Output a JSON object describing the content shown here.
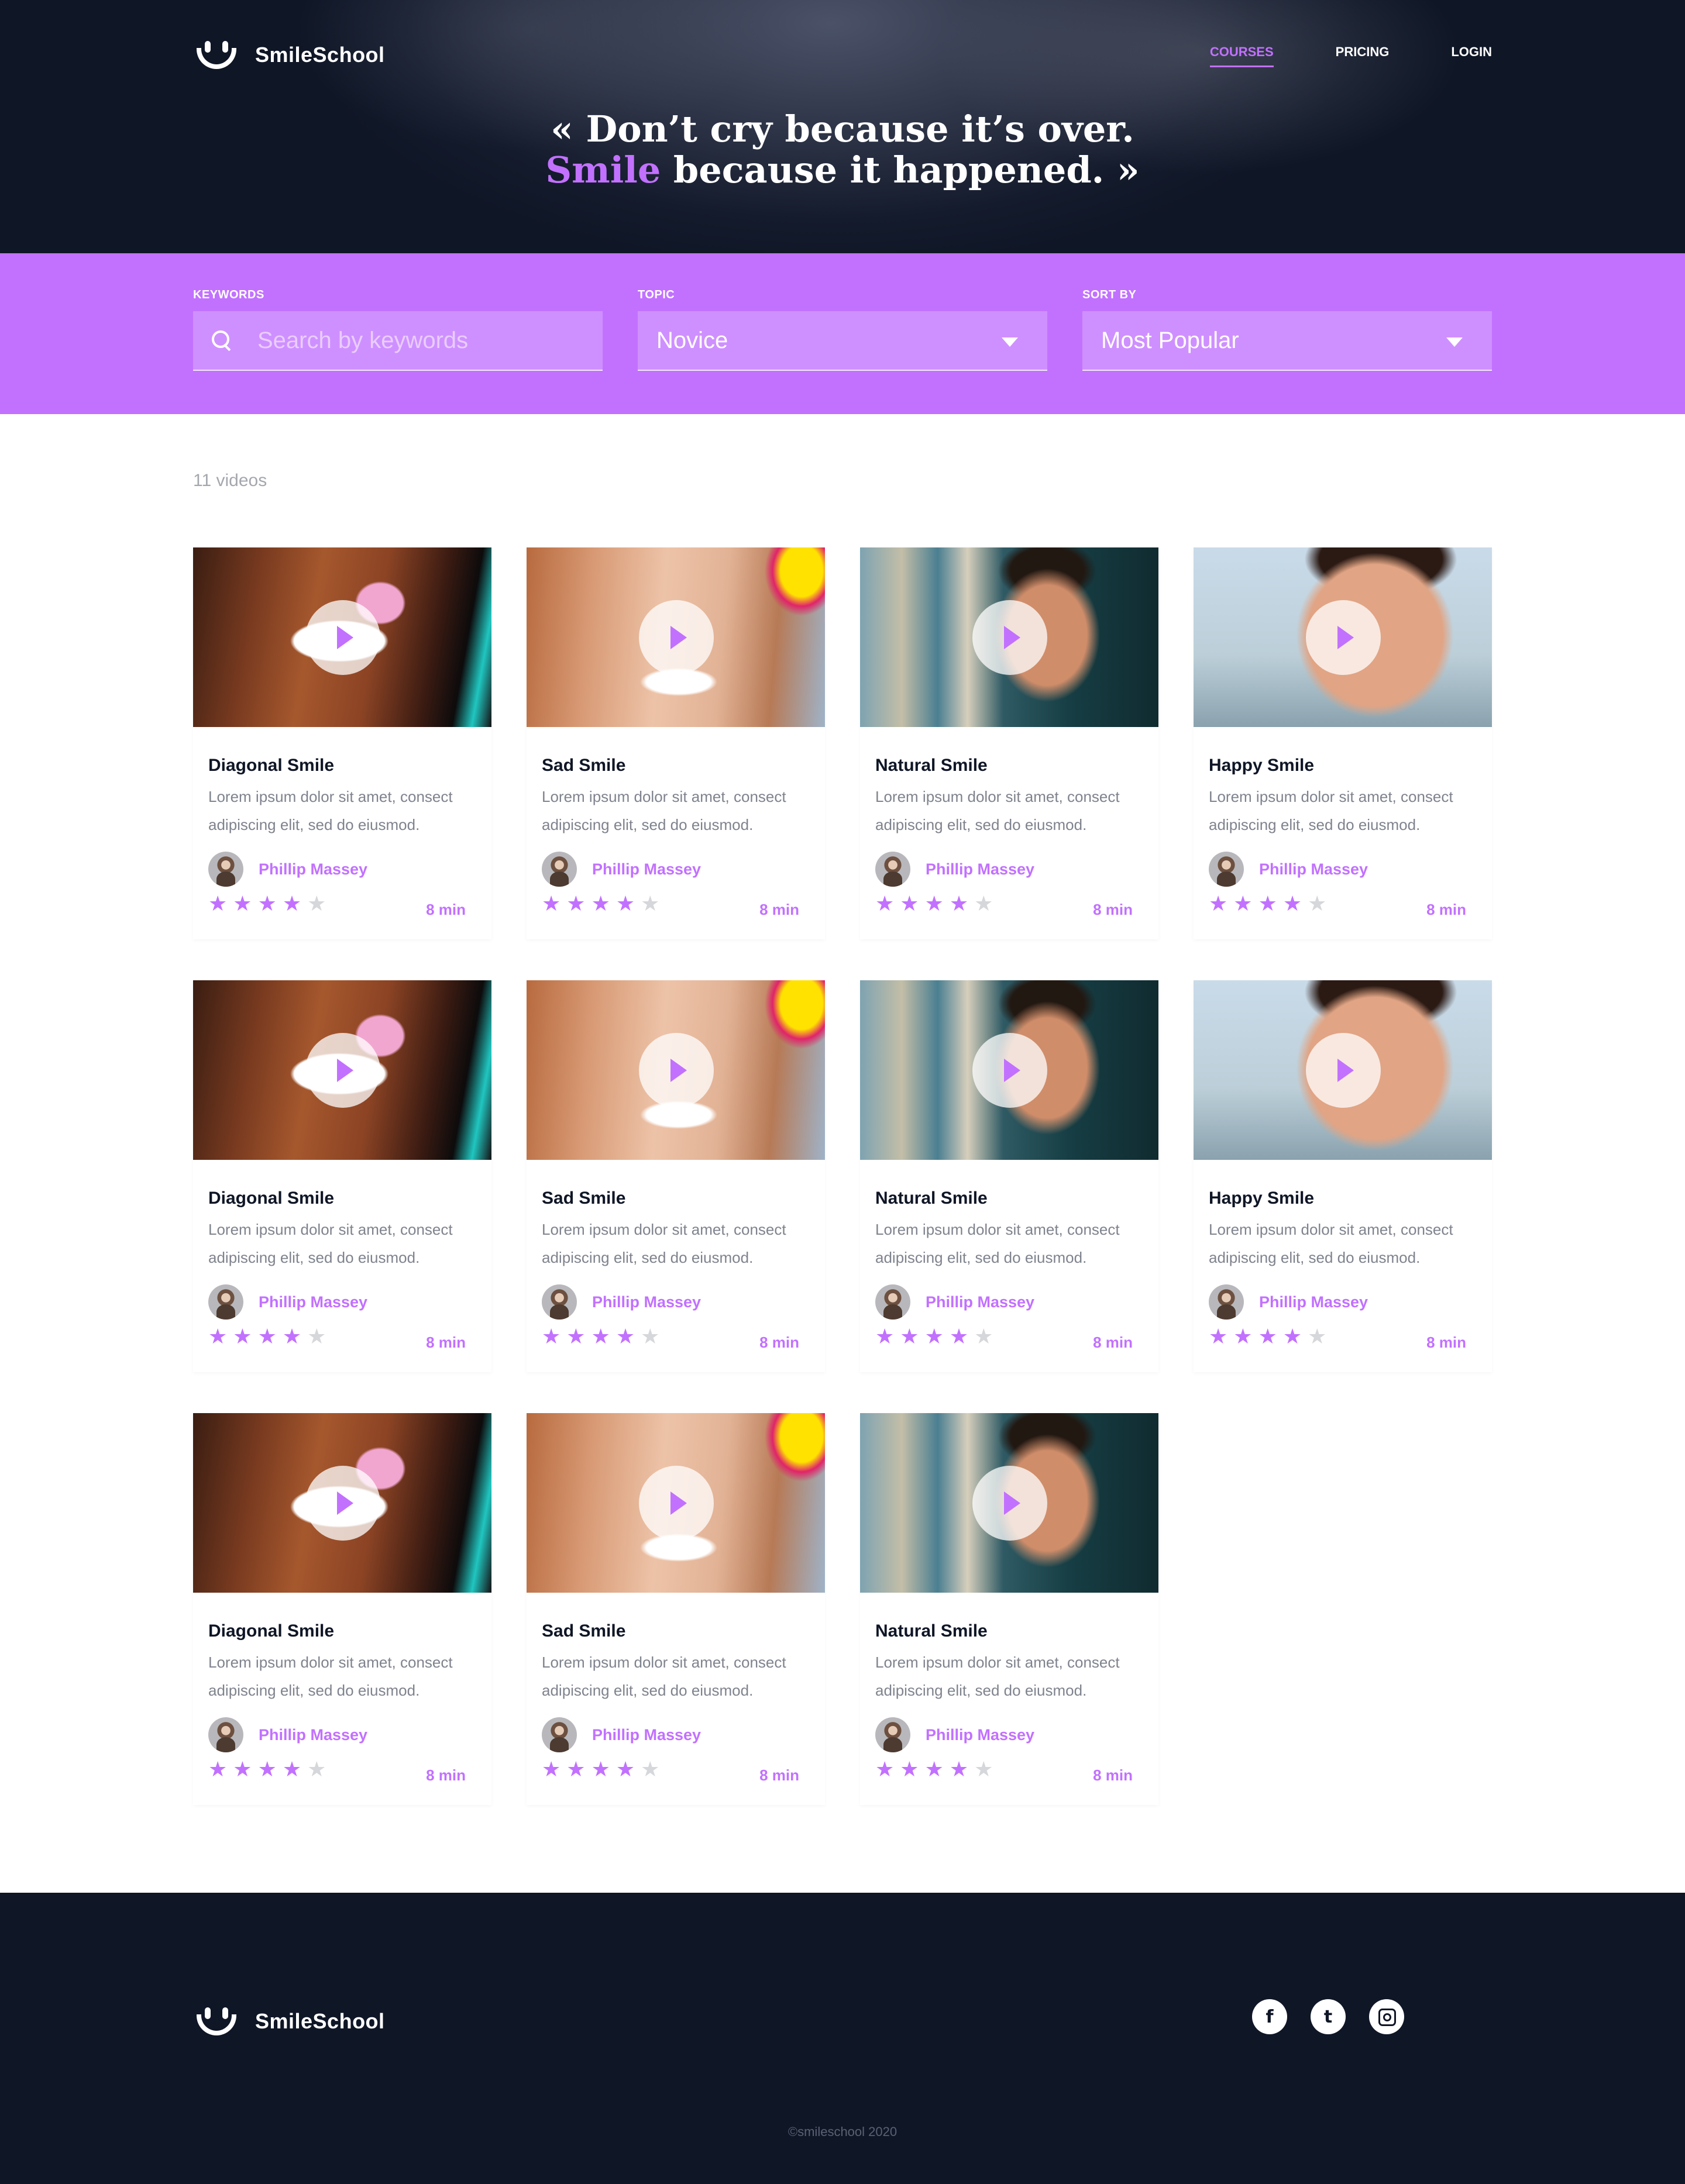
{
  "brand": {
    "name": "SmileSchool"
  },
  "nav": {
    "courses": "COURSES",
    "pricing": "PRICING",
    "login": "LOGIN"
  },
  "hero": {
    "quote_line1": "« Don’t cry because it’s over.",
    "quote_accent": "Smile",
    "quote_line2_rest": " because it happened. »"
  },
  "filters": {
    "keywords_label": "KEYWORDS",
    "keywords_placeholder": "Search by keywords",
    "topic_label": "TOPIC",
    "topic_value": "Novice",
    "sort_label": "SORT BY",
    "sort_value": "Most Popular"
  },
  "results": {
    "count_text": "11 videos"
  },
  "videos": [
    {
      "title": "Diagonal Smile",
      "desc": "Lorem ipsum dolor sit amet, consect adipiscing elit, sed do eiusmod.",
      "author": "Phillip Massey",
      "stars": 4,
      "duration": "8 min"
    },
    {
      "title": "Sad Smile",
      "desc": "Lorem ipsum dolor sit amet, consect adipiscing elit, sed do eiusmod.",
      "author": "Phillip Massey",
      "stars": 4,
      "duration": "8 min"
    },
    {
      "title": "Natural Smile",
      "desc": "Lorem ipsum dolor sit amet, consect adipiscing elit, sed do eiusmod.",
      "author": "Phillip Massey",
      "stars": 4,
      "duration": "8 min"
    },
    {
      "title": "Happy Smile",
      "desc": "Lorem ipsum dolor sit amet, consect adipiscing elit, sed do eiusmod.",
      "author": "Phillip Massey",
      "stars": 4,
      "duration": "8 min"
    },
    {
      "title": "Diagonal Smile",
      "desc": "Lorem ipsum dolor sit amet, consect adipiscing elit, sed do eiusmod.",
      "author": "Phillip Massey",
      "stars": 4,
      "duration": "8 min"
    },
    {
      "title": "Sad Smile",
      "desc": "Lorem ipsum dolor sit amet, consect adipiscing elit, sed do eiusmod.",
      "author": "Phillip Massey",
      "stars": 4,
      "duration": "8 min"
    },
    {
      "title": "Natural Smile",
      "desc": "Lorem ipsum dolor sit amet, consect adipiscing elit, sed do eiusmod.",
      "author": "Phillip Massey",
      "stars": 4,
      "duration": "8 min"
    },
    {
      "title": "Happy Smile",
      "desc": "Lorem ipsum dolor sit amet, consect adipiscing elit, sed do eiusmod.",
      "author": "Phillip Massey",
      "stars": 4,
      "duration": "8 min"
    },
    {
      "title": "Diagonal Smile",
      "desc": "Lorem ipsum dolor sit amet, consect adipiscing elit, sed do eiusmod.",
      "author": "Phillip Massey",
      "stars": 4,
      "duration": "8 min"
    },
    {
      "title": "Sad Smile",
      "desc": "Lorem ipsum dolor sit amet, consect adipiscing elit, sed do eiusmod.",
      "author": "Phillip Massey",
      "stars": 4,
      "duration": "8 min"
    },
    {
      "title": "Natural Smile",
      "desc": "Lorem ipsum dolor sit amet, consect adipiscing elit, sed do eiusmod.",
      "author": "Phillip Massey",
      "stars": 4,
      "duration": "8 min"
    }
  ],
  "rating_max": 5,
  "footer": {
    "social": [
      "facebook-icon",
      "twitter-icon",
      "instagram-icon"
    ],
    "copyright": "©smileschool 2020"
  },
  "colors": {
    "accent": "#c271ff",
    "dark": "#0f1626"
  }
}
